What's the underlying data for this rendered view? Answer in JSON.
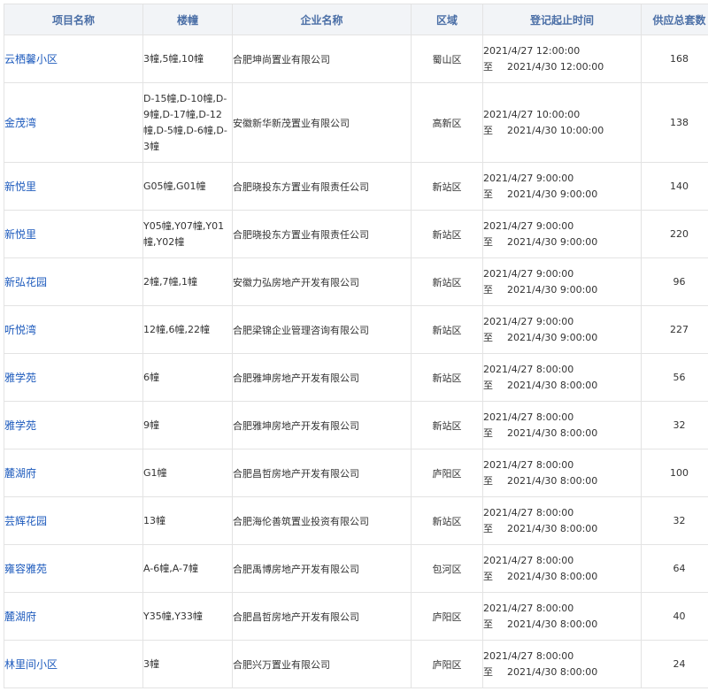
{
  "headers": {
    "name": "项目名称",
    "building": "楼幢",
    "company": "企业名称",
    "district": "区域",
    "period": "登记起止时间",
    "total": "供应总套数"
  },
  "rows": [
    {
      "name": "云栖馨小区",
      "building": "3幢,5幢,10幢",
      "company": "合肥坤尚置业有限公司",
      "district": "蜀山区",
      "start": "2021/4/27 12:00:00",
      "to": "至",
      "end": "2021/4/30 12:00:00",
      "total": "168"
    },
    {
      "name": "金茂湾",
      "building": "D-15幢,D-10幢,D-9幢,D-17幢,D-12幢,D-5幢,D-6幢,D-3幢",
      "company": "安徽新华新茂置业有限公司",
      "district": "高新区",
      "start": "2021/4/27 10:00:00",
      "to": "至",
      "end": "2021/4/30 10:00:00",
      "total": "138"
    },
    {
      "name": "新悦里",
      "building": "G05幢,G01幢",
      "company": "合肥晓投东方置业有限责任公司",
      "district": "新站区",
      "start": "2021/4/27 9:00:00",
      "to": "至",
      "end": "2021/4/30 9:00:00",
      "total": "140"
    },
    {
      "name": "新悦里",
      "building": "Y05幢,Y07幢,Y01幢,Y02幢",
      "company": "合肥晓投东方置业有限责任公司",
      "district": "新站区",
      "start": "2021/4/27 9:00:00",
      "to": "至",
      "end": "2021/4/30 9:00:00",
      "total": "220"
    },
    {
      "name": "新弘花园",
      "building": "2幢,7幢,1幢",
      "company": "安徽力弘房地产开发有限公司",
      "district": "新站区",
      "start": "2021/4/27 9:00:00",
      "to": "至",
      "end": "2021/4/30 9:00:00",
      "total": "96"
    },
    {
      "name": "听悦湾",
      "building": "12幢,6幢,22幢",
      "company": "合肥梁锦企业管理咨询有限公司",
      "district": "新站区",
      "start": "2021/4/27 9:00:00",
      "to": "至",
      "end": "2021/4/30 9:00:00",
      "total": "227"
    },
    {
      "name": "雅学苑",
      "building": "6幢",
      "company": "合肥雅坤房地产开发有限公司",
      "district": "新站区",
      "start": "2021/4/27 8:00:00",
      "to": "至",
      "end": "2021/4/30 8:00:00",
      "total": "56"
    },
    {
      "name": "雅学苑",
      "building": "9幢",
      "company": "合肥雅坤房地产开发有限公司",
      "district": "新站区",
      "start": "2021/4/27 8:00:00",
      "to": "至",
      "end": "2021/4/30 8:00:00",
      "total": "32"
    },
    {
      "name": "麓湖府",
      "building": "G1幢",
      "company": "合肥昌哲房地产开发有限公司",
      "district": "庐阳区",
      "start": "2021/4/27 8:00:00",
      "to": "至",
      "end": "2021/4/30 8:00:00",
      "total": "100"
    },
    {
      "name": "芸辉花园",
      "building": "13幢",
      "company": "合肥海伦善筑置业投资有限公司",
      "district": "新站区",
      "start": "2021/4/27 8:00:00",
      "to": "至",
      "end": "2021/4/30 8:00:00",
      "total": "32"
    },
    {
      "name": "雍容雅苑",
      "building": "A-6幢,A-7幢",
      "company": "合肥禹博房地产开发有限公司",
      "district": "包河区",
      "start": "2021/4/27 8:00:00",
      "to": "至",
      "end": "2021/4/30 8:00:00",
      "total": "64"
    },
    {
      "name": "麓湖府",
      "building": "Y35幢,Y33幢",
      "company": "合肥昌哲房地产开发有限公司",
      "district": "庐阳区",
      "start": "2021/4/27 8:00:00",
      "to": "至",
      "end": "2021/4/30 8:00:00",
      "total": "40"
    },
    {
      "name": "林里间小区",
      "building": "3幢",
      "company": "合肥兴万置业有限公司",
      "district": "庐阳区",
      "start": "2021/4/27 8:00:00",
      "to": "至",
      "end": "2021/4/30 8:00:00",
      "total": "24"
    }
  ],
  "colors": {
    "header_bg": "#f2f4f7",
    "header_text": "#4a6ea6",
    "link": "#1e5bbd",
    "border": "#e3e3e3"
  }
}
